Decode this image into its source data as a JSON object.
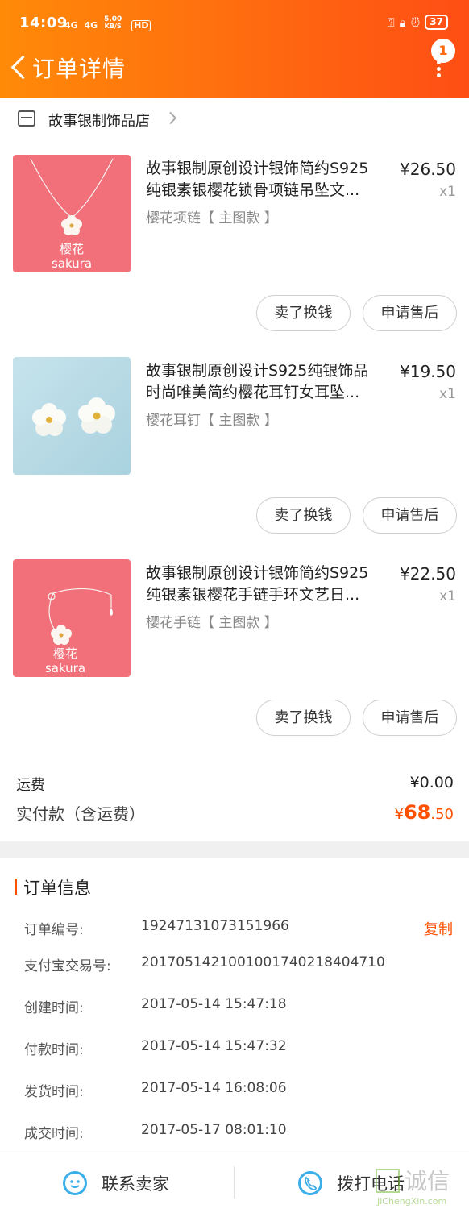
{
  "status": {
    "time": "14:09",
    "network_left": "4G",
    "network_right": "4G",
    "speed_value": "5.00",
    "speed_unit": "KB/S",
    "hd": "HD",
    "battery": "37"
  },
  "nav": {
    "title": "订单详情",
    "badge": "1"
  },
  "shop": {
    "name": "故事银制饰品店"
  },
  "products": [
    {
      "title_line1": "故事银制原创设计银饰简约S925",
      "title_line2": "纯银素银樱花锁骨项链吊坠文...",
      "sku": "樱花项链【 主图款 】",
      "price": "¥26.50",
      "qty": "x1",
      "img_text_cn": "樱花",
      "img_text_en": "sakura",
      "btn_refund": "卖了换钱",
      "btn_service": "申请售后"
    },
    {
      "title_line1": "故事银制原创设计S925纯银饰品",
      "title_line2": "时尚唯美简约樱花耳钉女耳坠...",
      "sku": "樱花耳钉【 主图款 】",
      "price": "¥19.50",
      "qty": "x1",
      "img_text_cn": "",
      "img_text_en": "",
      "btn_refund": "卖了换钱",
      "btn_service": "申请售后"
    },
    {
      "title_line1": "故事银制原创设计银饰简约S925",
      "title_line2": "纯银素银樱花手链手环文艺日...",
      "sku": "樱花手链【 主图款 】",
      "price": "¥22.50",
      "qty": "x1",
      "img_text_cn": "樱花",
      "img_text_en": "sakura",
      "btn_refund": "卖了换钱",
      "btn_service": "申请售后"
    }
  ],
  "fees": {
    "shipping_label": "运费",
    "shipping_value": "¥0.00",
    "paid_label": "实付款（含运费）",
    "paid_currency": "¥",
    "paid_integer": "68",
    "paid_decimal": ".50"
  },
  "order_info": {
    "title": "订单信息",
    "copy_label": "复制",
    "rows": [
      {
        "label": "订单编号:",
        "value": "19247131073151966"
      },
      {
        "label": "支付宝交易号:",
        "value": "2017051421001001740218404710"
      },
      {
        "label": "创建时间:",
        "value": "2017-05-14 15:47:18"
      },
      {
        "label": "付款时间:",
        "value": "2017-05-14 15:47:32"
      },
      {
        "label": "发货时间:",
        "value": "2017-05-14 16:08:06"
      },
      {
        "label": "成交时间:",
        "value": "2017-05-17 08:01:10"
      }
    ]
  },
  "bottom": {
    "contact_label": "联系卖家",
    "call_label": "拨打电话"
  },
  "watermark": {
    "cn": "诚信",
    "en": "JiChengXin.com"
  },
  "colors": {
    "accent": "#ff5000",
    "header_start": "#ff8a08",
    "header_end": "#ff4e14",
    "pink_bg": "#f2707a",
    "blue_bg": "#b7dbe6",
    "icon_blue": "#3aaee8"
  }
}
